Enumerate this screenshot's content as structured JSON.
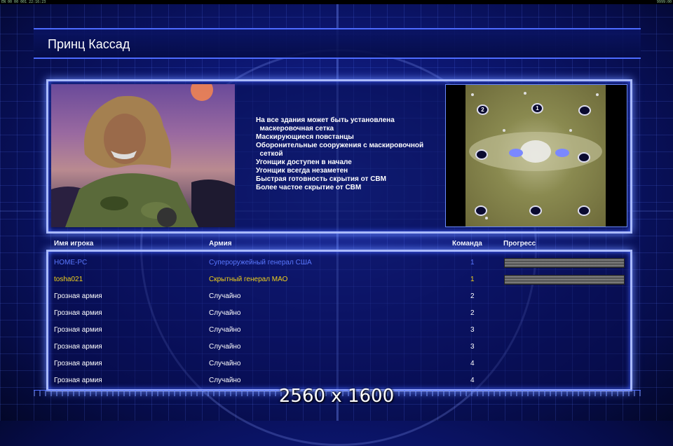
{
  "topbar": {
    "left": "EN 00 00 001 22:16:23",
    "right": "9999:00"
  },
  "header": {
    "title": "Принц Кассад"
  },
  "briefing": {
    "features": [
      "На все здания может быть установлена",
      "  маскеровочная сетка",
      "Маскирующиеся повстанцы",
      "Оборонительные сооружения с маскировочной",
      "  сеткой",
      "Угонщик доступен в начале",
      "Угонщик всегда незаметен",
      "Быстрая готовность скрытия от СВМ",
      "Более частое скрытие от СВМ"
    ],
    "map_slots": [
      "2",
      "1"
    ]
  },
  "table": {
    "headers": {
      "name": "Имя игрока",
      "army": "Армия",
      "team": "Команда",
      "progress": "Прогресс"
    },
    "rows": [
      {
        "name": "HOME-PC",
        "army": "Супероружейный генерал США",
        "team": "1",
        "color": "#5a78ff",
        "progress": 1.0
      },
      {
        "name": "tosha021",
        "army": "Скрытный генерал МАО",
        "team": "1",
        "color": "#f2d21a",
        "progress": 1.0
      },
      {
        "name": "Грозная армия",
        "army": "Случайно",
        "team": "2",
        "color": "#ffffff"
      },
      {
        "name": "Грозная армия",
        "army": "Случайно",
        "team": "2",
        "color": "#ffffff"
      },
      {
        "name": "Грозная армия",
        "army": "Случайно",
        "team": "3",
        "color": "#ffffff"
      },
      {
        "name": "Грозная армия",
        "army": "Случайно",
        "team": "3",
        "color": "#ffffff"
      },
      {
        "name": "Грозная армия",
        "army": "Случайно",
        "team": "4",
        "color": "#ffffff"
      },
      {
        "name": "Грозная армия",
        "army": "Случайно",
        "team": "4",
        "color": "#ffffff"
      }
    ]
  },
  "overlay": {
    "resolution": "2560 x 1600"
  },
  "colors": {
    "accent": "#aabaff",
    "background": "#0c1670"
  }
}
